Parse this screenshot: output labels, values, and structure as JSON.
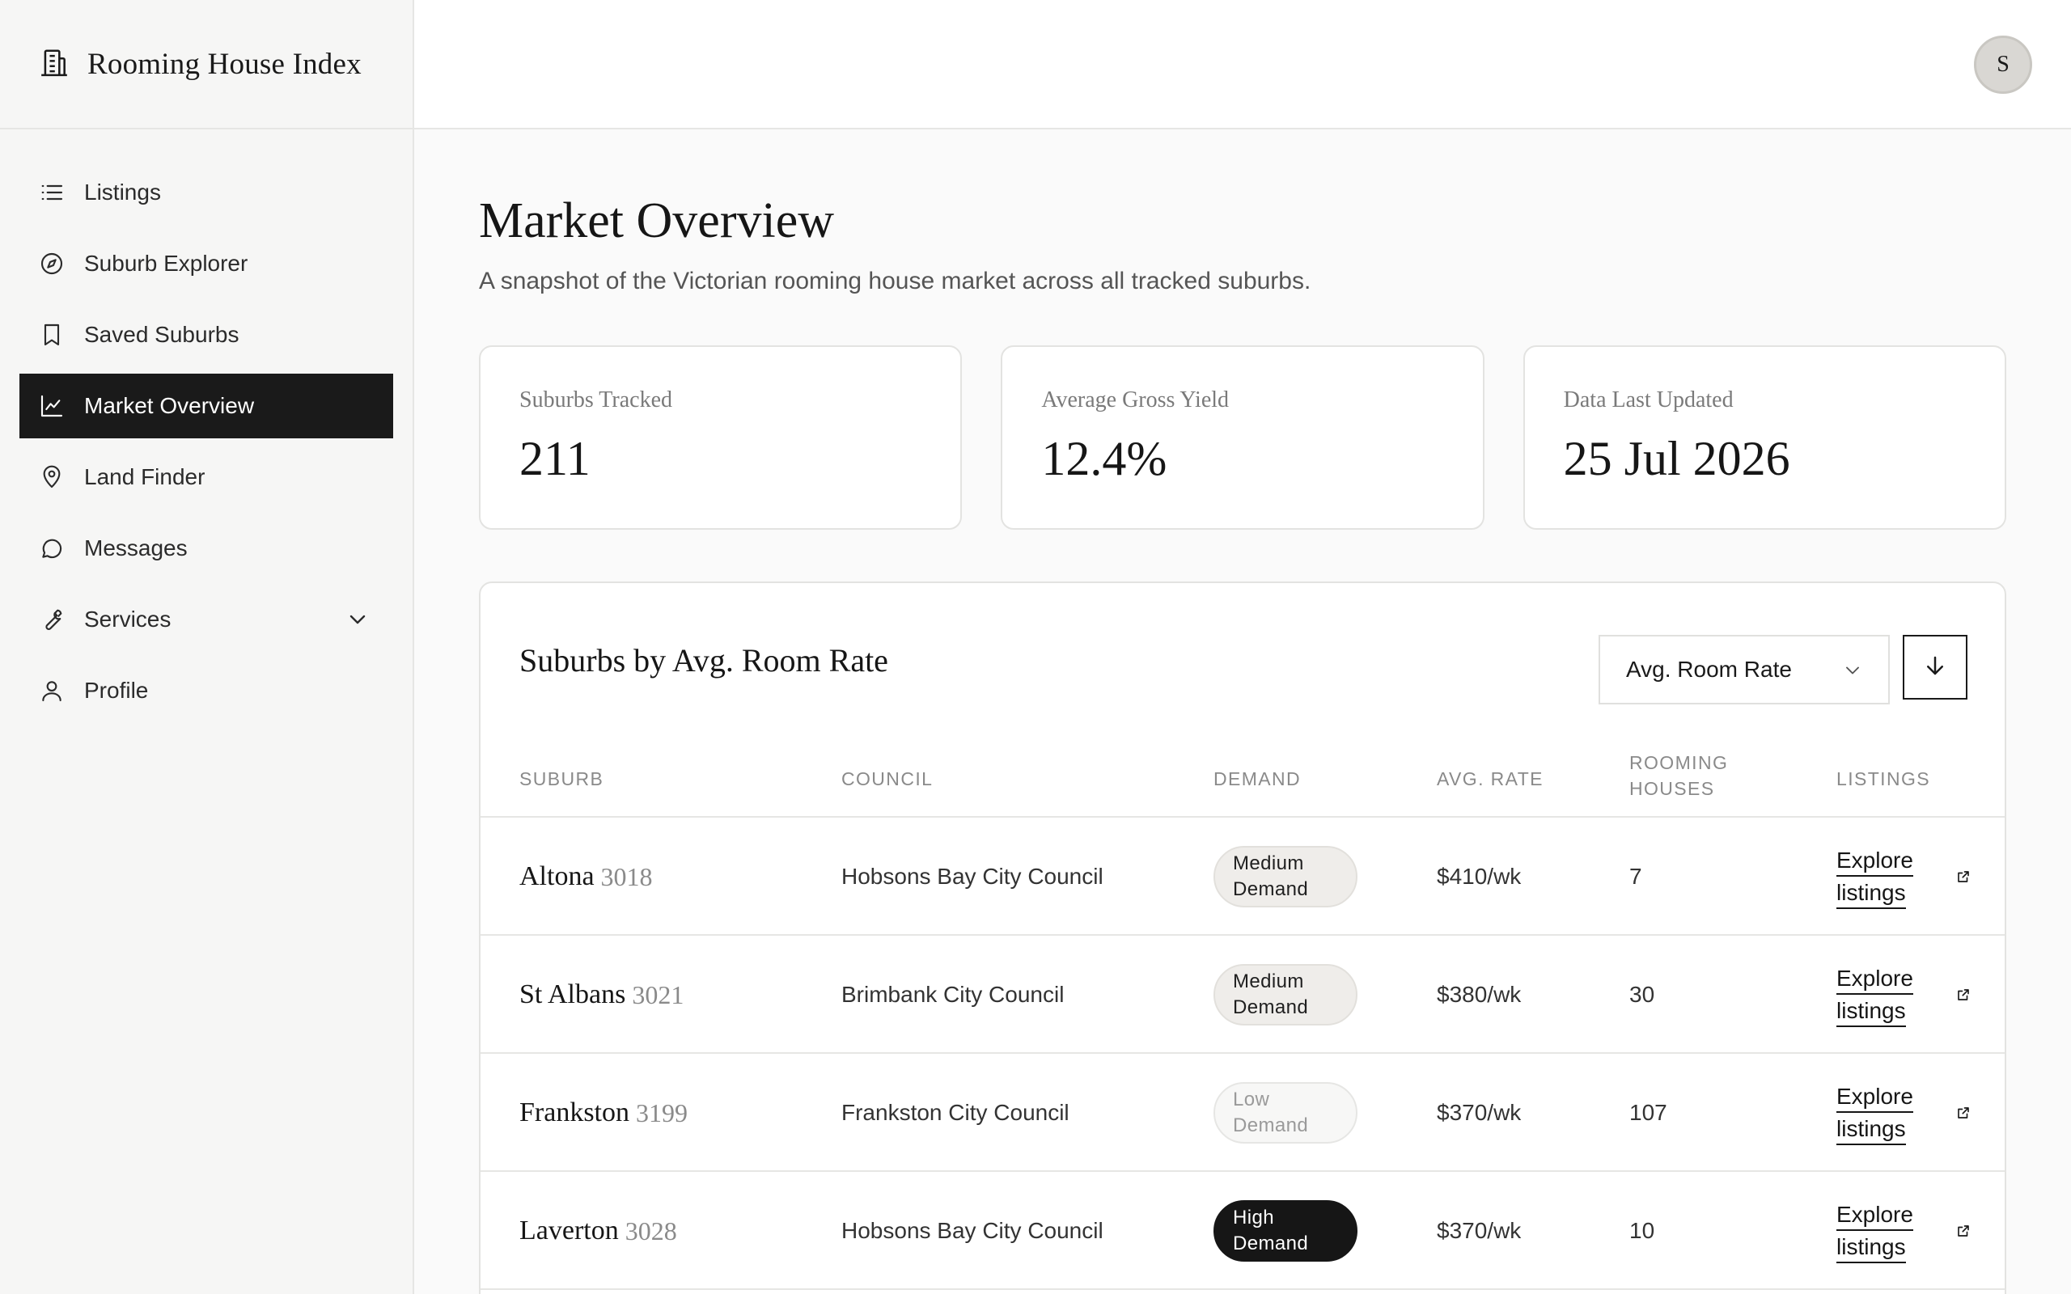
{
  "app": {
    "title": "Rooming House Index",
    "brand_icon": "building-icon"
  },
  "user": {
    "initial": "S"
  },
  "sidebar": {
    "items": [
      {
        "label": "Listings",
        "icon": "list-icon",
        "active": false
      },
      {
        "label": "Suburb Explorer",
        "icon": "compass-icon",
        "active": false
      },
      {
        "label": "Saved Suburbs",
        "icon": "bookmark-icon",
        "active": false
      },
      {
        "label": "Market Overview",
        "icon": "chart-line-icon",
        "active": true
      },
      {
        "label": "Land Finder",
        "icon": "map-pin-icon",
        "active": false
      },
      {
        "label": "Messages",
        "icon": "message-icon",
        "active": false
      },
      {
        "label": "Services",
        "icon": "wrench-icon",
        "active": false,
        "expandable": true
      },
      {
        "label": "Profile",
        "icon": "user-icon",
        "active": false
      }
    ]
  },
  "page": {
    "title": "Market Overview",
    "subtitle": "A snapshot of the Victorian rooming house market across all tracked suburbs."
  },
  "stats": [
    {
      "label": "Suburbs Tracked",
      "value": "211"
    },
    {
      "label": "Average Gross Yield",
      "value": "12.4%"
    },
    {
      "label": "Data Last Updated",
      "value": "25 Jul 2026"
    }
  ],
  "table": {
    "title": "Suburbs by Avg. Room Rate",
    "sort_by": "Avg. Room Rate",
    "columns": {
      "suburb": "SUBURB",
      "council": "COUNCIL",
      "demand": "DEMAND",
      "rate": "AVG. RATE",
      "houses_line1": "ROOMING",
      "houses_line2": "HOUSES",
      "listings": "LISTINGS"
    },
    "rows": [
      {
        "suburb": "Altona",
        "postcode": "3018",
        "council": "Hobsons Bay City Council",
        "demand_level": "medium",
        "demand_line1": "Medium",
        "demand_line2": "Demand",
        "rate": "$410/wk",
        "houses": "7",
        "link_line1": "Explore",
        "link_line2": "listings"
      },
      {
        "suburb": "St Albans",
        "postcode": "3021",
        "council": "Brimbank City Council",
        "demand_level": "medium",
        "demand_line1": "Medium",
        "demand_line2": "Demand",
        "rate": "$380/wk",
        "houses": "30",
        "link_line1": "Explore",
        "link_line2": "listings"
      },
      {
        "suburb": "Frankston",
        "postcode": "3199",
        "council": "Frankston City Council",
        "demand_level": "low",
        "demand_line1": "Low",
        "demand_line2": "Demand",
        "rate": "$370/wk",
        "houses": "107",
        "link_line1": "Explore",
        "link_line2": "listings"
      },
      {
        "suburb": "Laverton",
        "postcode": "3028",
        "council": "Hobsons Bay City Council",
        "demand_level": "high",
        "demand_line1": "High",
        "demand_line2": "Demand",
        "rate": "$370/wk",
        "houses": "10",
        "link_line1": "Explore",
        "link_line2": "listings"
      }
    ]
  }
}
